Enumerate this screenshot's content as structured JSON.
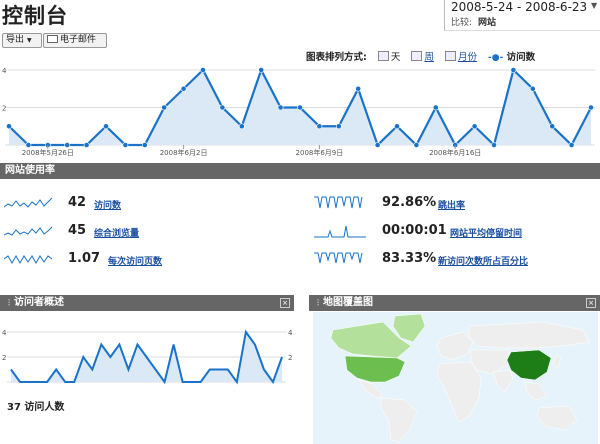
{
  "header": {
    "title": "控制台",
    "date_range": "2008-5-24 - 2008-6-23",
    "compare_label": "比较:",
    "compare_value": "网站"
  },
  "toolbar": {
    "export_label": "导出",
    "email_label": "电子邮件"
  },
  "chart_options": {
    "label": "图表排列方式:",
    "options": [
      "天",
      "周",
      "月份",
      "访问数"
    ],
    "selected": "访问数"
  },
  "chart_data": [
    {
      "type": "area",
      "x": [
        "2008-5-24",
        "2008-5-25",
        "2008-5-26",
        "2008-5-27",
        "2008-5-28",
        "2008-5-29",
        "2008-5-30",
        "2008-5-31",
        "2008-6-1",
        "2008-6-2",
        "2008-6-3",
        "2008-6-4",
        "2008-6-5",
        "2008-6-6",
        "2008-6-7",
        "2008-6-8",
        "2008-6-9",
        "2008-6-10",
        "2008-6-11",
        "2008-6-12",
        "2008-6-13",
        "2008-6-14",
        "2008-6-15",
        "2008-6-16",
        "2008-6-17",
        "2008-6-18",
        "2008-6-19",
        "2008-6-20",
        "2008-6-21",
        "2008-6-22",
        "2008-6-23"
      ],
      "values": [
        1,
        0,
        0,
        0,
        0,
        1,
        0,
        0,
        2,
        3,
        4,
        2,
        1,
        4,
        2,
        2,
        1,
        1,
        3,
        0,
        1,
        0,
        2,
        0,
        1,
        0,
        4,
        3,
        1,
        0,
        2
      ],
      "xtick_labels": [
        "2008年5月26日",
        "2008年6月2日",
        "2008年6月9日",
        "2008年6月16日"
      ],
      "ytick_labels": [
        "4",
        "2"
      ],
      "ylim": [
        0,
        4
      ],
      "series": [
        {
          "name": "访问数",
          "color": "#1a73c8"
        }
      ]
    },
    {
      "type": "area",
      "values": [
        1,
        0,
        0,
        0,
        0,
        1,
        0,
        0,
        2,
        1,
        3,
        2,
        3,
        1,
        3,
        2,
        1,
        0,
        3,
        0,
        0,
        0,
        1,
        1,
        1,
        0,
        4,
        3,
        1,
        0,
        2
      ],
      "ytick_labels": [
        "4",
        "2"
      ],
      "ylim": [
        0,
        4
      ]
    }
  ],
  "site_usage": {
    "title": "网站使用率",
    "metrics": [
      {
        "value": "42",
        "label": "访问数"
      },
      {
        "value": "45",
        "label": "综合浏览量"
      },
      {
        "value": "1.07",
        "label": "每次访问页数"
      },
      {
        "value": "92.86%",
        "label": "跳出率"
      },
      {
        "value": "00:00:01",
        "label": "网站平均停留时间"
      },
      {
        "value": "83.33%",
        "label": "新访问次数所占百分比"
      }
    ]
  },
  "visitors_overview": {
    "title": "访问者概述",
    "count_text": "37 访问人数"
  },
  "map_overlay": {
    "title": "地图覆盖图"
  },
  "colors": {
    "line": "#1a73c8",
    "fill": "#dbe9f6",
    "header_bg": "#666666",
    "link": "#1a4fa0",
    "map_water": "#e6f3fa",
    "map_land": "#eeeeee",
    "map_light": "#b3e09a",
    "map_mid": "#6cbf4f",
    "map_dark": "#1d7d16"
  }
}
